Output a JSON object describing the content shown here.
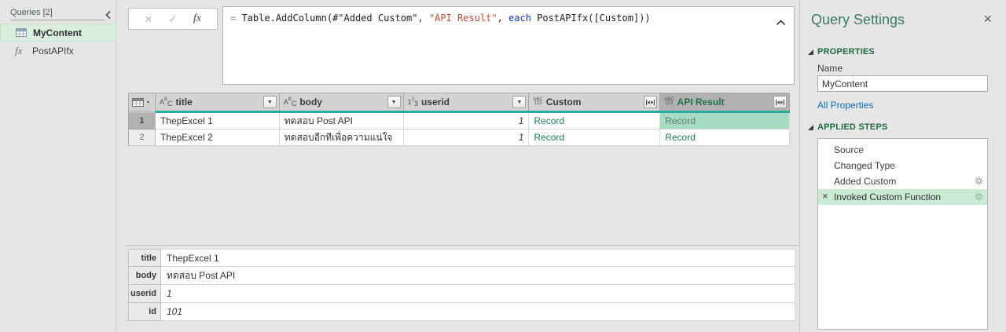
{
  "sidebar": {
    "header": "Queries [2]",
    "items": [
      {
        "label": "MyContent"
      },
      {
        "label": "PostAPIfx"
      }
    ]
  },
  "toolbar": {
    "cancel": "×",
    "commit": "✓",
    "fx": "fx"
  },
  "formula": {
    "eq": "= ",
    "pre": "Table.AddColumn(#\"Added Custom\", ",
    "string": "\"API Result\"",
    "mid": ", ",
    "keyword": "each",
    "post": " PostAPIfx([Custom]))"
  },
  "grid": {
    "columns": [
      {
        "name": "title",
        "type": "text"
      },
      {
        "name": "body",
        "type": "text"
      },
      {
        "name": "userid",
        "type": "whole-number"
      },
      {
        "name": "Custom",
        "type": "any"
      },
      {
        "name": "API Result",
        "type": "any",
        "selected": true
      }
    ],
    "rows": [
      {
        "num": "1",
        "title": "ThepExcel 1",
        "body": "ทดสอบ Post API",
        "userid": "1",
        "custom": "Record",
        "api_result": "Record"
      },
      {
        "num": "2",
        "title": "ThepExcel 2",
        "body": "ทดสอบอีกทีเพื่อความแน่ใจ",
        "userid": "1",
        "custom": "Record",
        "api_result": "Record"
      }
    ]
  },
  "preview": {
    "fields": [
      {
        "label": "title",
        "value": "ThepExcel 1"
      },
      {
        "label": "body",
        "value": "ทดสอบ Post API"
      },
      {
        "label": "userid",
        "value": "1"
      },
      {
        "label": "id",
        "value": "101"
      }
    ]
  },
  "query_settings": {
    "title": "Query Settings",
    "close": "×",
    "properties_header": "PROPERTIES",
    "name_label": "Name",
    "name_value": "MyContent",
    "all_properties": "All Properties",
    "applied_steps_header": "APPLIED STEPS",
    "steps": [
      {
        "label": "Source"
      },
      {
        "label": "Changed Type"
      },
      {
        "label": "Added Custom"
      },
      {
        "label": "Invoked Custom Function"
      }
    ]
  },
  "icons": {
    "abc": [
      "A",
      "B",
      "C"
    ],
    "num": [
      "1",
      "2",
      "3"
    ],
    "any": [
      "ABC",
      "123"
    ],
    "dropdown": "▼",
    "corner_caret": "▾",
    "delete_x": "×"
  },
  "colors": {
    "accent_teal": "#21AF9C",
    "selected_cell_bg": "#A6DAC3",
    "record_link_green": "#1F7B5C",
    "section_header_green": "#1E6B43",
    "query_settings_title_green": "#3B7A5F",
    "link_blue": "#0D6CBD",
    "step_selected_bg": "#C9EAD4",
    "sidebar_selected_bg": "#D9EEDD",
    "formula_string_red": "#C8473C",
    "formula_keyword_blue": "#1437CF"
  }
}
